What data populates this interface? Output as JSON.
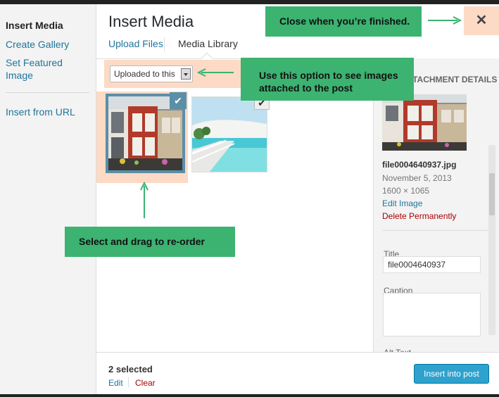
{
  "sidebar": {
    "title": "Insert Media",
    "items": [
      {
        "label": "Create Gallery"
      },
      {
        "label": "Set Featured Image"
      },
      {
        "label": "Insert from URL"
      }
    ]
  },
  "header": {
    "title": "Insert Media",
    "tabs": [
      {
        "label": "Upload Files"
      },
      {
        "label": "Media Library"
      }
    ]
  },
  "filter": {
    "selected": "Uploaded to this"
  },
  "details": {
    "header": "ATTACHMENT DETAILS",
    "filename": "file0004640937.jpg",
    "date": "November 5, 2013",
    "dimensions": "1600 × 1065",
    "edit_link": "Edit Image",
    "delete_link": "Delete Permanently",
    "title_label": "Title",
    "title_value": "file0004640937",
    "caption_label": "Caption",
    "alt_label": "Alt Text"
  },
  "footer": {
    "selected_count": "2 selected",
    "edit": "Edit",
    "clear": "Clear",
    "insert_button": "Insert into post"
  },
  "callouts": {
    "close": "Close when you’re finished.",
    "option": "Use this option to see images attached to the post",
    "select": "Select and drag to re-order"
  },
  "icons": {
    "close": "close-icon",
    "check": "checkmark-icon",
    "dropdown": "chevron-down-icon"
  },
  "colors": {
    "accent": "#21759b",
    "callout": "#3cb371",
    "highlight": "#fcdac5",
    "button": "#2ea2cc",
    "delete": "#aa0000"
  }
}
